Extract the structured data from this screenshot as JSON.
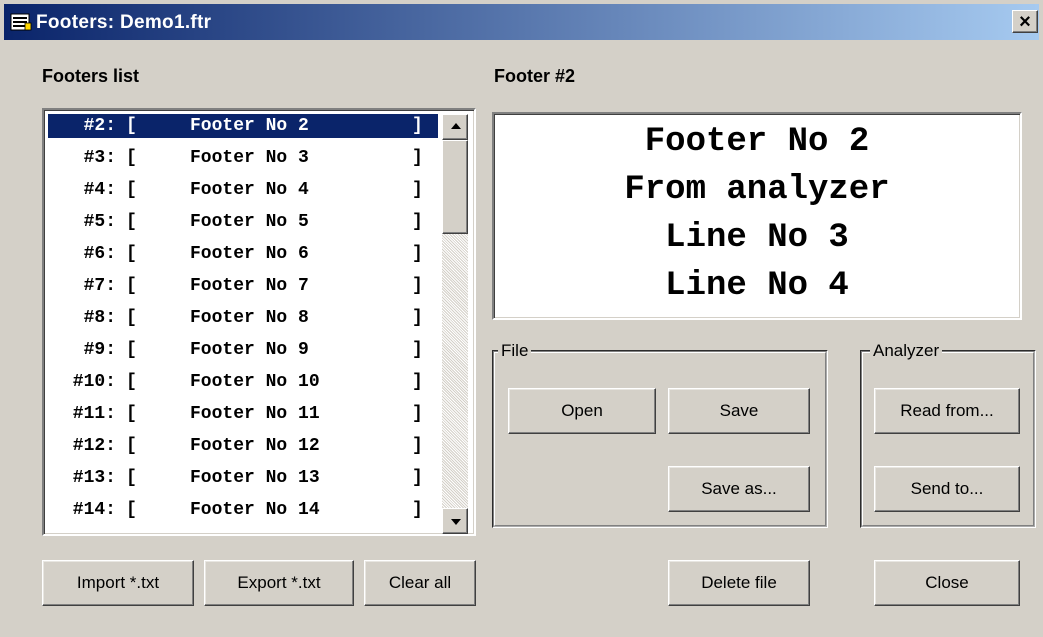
{
  "window": {
    "title": "Footers: Demo1.ftr",
    "icon": "window-app-icon",
    "close_glyph": "×"
  },
  "footers_list": {
    "label": "Footers list",
    "items": [
      {
        "num": "#2:",
        "open": "[",
        "text": "Footer No 2",
        "close": "]",
        "selected": true
      },
      {
        "num": "#3:",
        "open": "[",
        "text": "Footer No 3",
        "close": "]"
      },
      {
        "num": "#4:",
        "open": "[",
        "text": "Footer No 4",
        "close": "]"
      },
      {
        "num": "#5:",
        "open": "[",
        "text": "Footer No 5",
        "close": "]"
      },
      {
        "num": "#6:",
        "open": "[",
        "text": "Footer No 6",
        "close": "]"
      },
      {
        "num": "#7:",
        "open": "[",
        "text": "Footer No 7",
        "close": "]"
      },
      {
        "num": "#8:",
        "open": "[",
        "text": "Footer No 8",
        "close": "]"
      },
      {
        "num": "#9:",
        "open": "[",
        "text": "Footer No 9",
        "close": "]"
      },
      {
        "num": "#10:",
        "open": "[",
        "text": "Footer No 10",
        "close": "]"
      },
      {
        "num": "#11:",
        "open": "[",
        "text": "Footer No 11",
        "close": "]"
      },
      {
        "num": "#12:",
        "open": "[",
        "text": "Footer No 12",
        "close": "]"
      },
      {
        "num": "#13:",
        "open": "[",
        "text": "Footer No 13",
        "close": "]"
      },
      {
        "num": "#14:",
        "open": "[",
        "text": "Footer No 14",
        "close": "]"
      }
    ]
  },
  "footer_preview": {
    "label": "Footer #2",
    "lines": [
      "Footer No 2",
      "From analyzer",
      "Line No 3",
      "Line No 4"
    ]
  },
  "file_group": {
    "legend": "File",
    "open_label": "Open",
    "save_label": "Save",
    "save_as_label": "Save as..."
  },
  "analyzer_group": {
    "legend": "Analyzer",
    "read_from_label": "Read from...",
    "send_to_label": "Send to..."
  },
  "bottom_buttons": {
    "import_label": "Import *.txt",
    "export_label": "Export *.txt",
    "clear_all_label": "Clear all",
    "delete_file_label": "Delete file",
    "close_label": "Close"
  },
  "colors": {
    "selection": "#0a246a",
    "face": "#d4d0c8"
  }
}
